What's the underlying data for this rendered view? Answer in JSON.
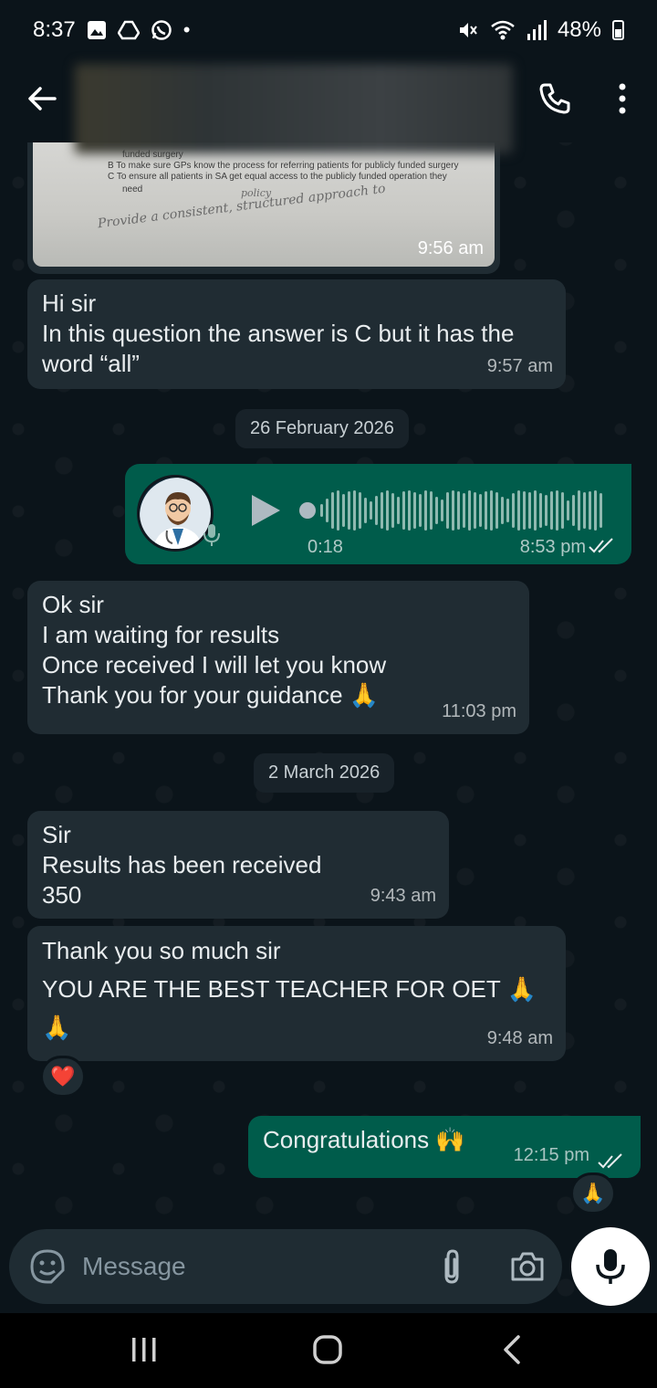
{
  "status_bar": {
    "time": "8:37",
    "battery": "48%",
    "icons": [
      "gallery-icon",
      "drive-icon",
      "whatsapp-icon",
      "dot",
      "mute-icon",
      "wifi-icon",
      "signal-icon",
      "battery-icon"
    ]
  },
  "header": {
    "back_icon": "arrow-left-icon",
    "call_icon": "phone-icon",
    "menu_icon": "more-vertical-icon"
  },
  "image_message": {
    "lines": [
      "funded surgery",
      "B  To make sure GPs know the process for referring patients for publicly funded surgery",
      "C  To ensure all patients in SA get equal access to the publicly funded operation they",
      "need"
    ],
    "handwriting": "Provide a consistent, structured approach to",
    "handwriting2": "policy",
    "time": "9:56 am"
  },
  "messages": [
    {
      "id": "m1",
      "text": "Hi sir\nIn this question the answer is C but it has the word “all”",
      "time": "9:57 am",
      "direction": "in"
    },
    {
      "id": "m2",
      "text": "Ok sir\nI am waiting for results\nOnce received I will let you know\nThank you for your guidance 🙏",
      "time": "11:03 pm",
      "direction": "in"
    },
    {
      "id": "m3",
      "text": "Sir\nResults has been received\n350",
      "time": "9:43 am",
      "direction": "in"
    },
    {
      "id": "m4",
      "text": "Thank you so much sir\nYOU ARE THE BEST TEACHER FOR OET 🙏\n🙏",
      "time": "9:48 am",
      "direction": "in",
      "reaction": "❤️"
    },
    {
      "id": "m5",
      "text": "Congratulations 🙌",
      "time": "12:15 pm",
      "direction": "out",
      "reaction": "🙏"
    }
  ],
  "dates": {
    "d1": "26 February 2026",
    "d2": "2 March 2026"
  },
  "voice_message": {
    "duration": "0:18",
    "time": "8:53 pm",
    "progress": 0.0
  },
  "input": {
    "placeholder": "Message"
  },
  "colors": {
    "incoming": "#202c33",
    "outgoing": "#005c4b",
    "background": "#0b141a",
    "read_ticks": "#e9edef"
  }
}
